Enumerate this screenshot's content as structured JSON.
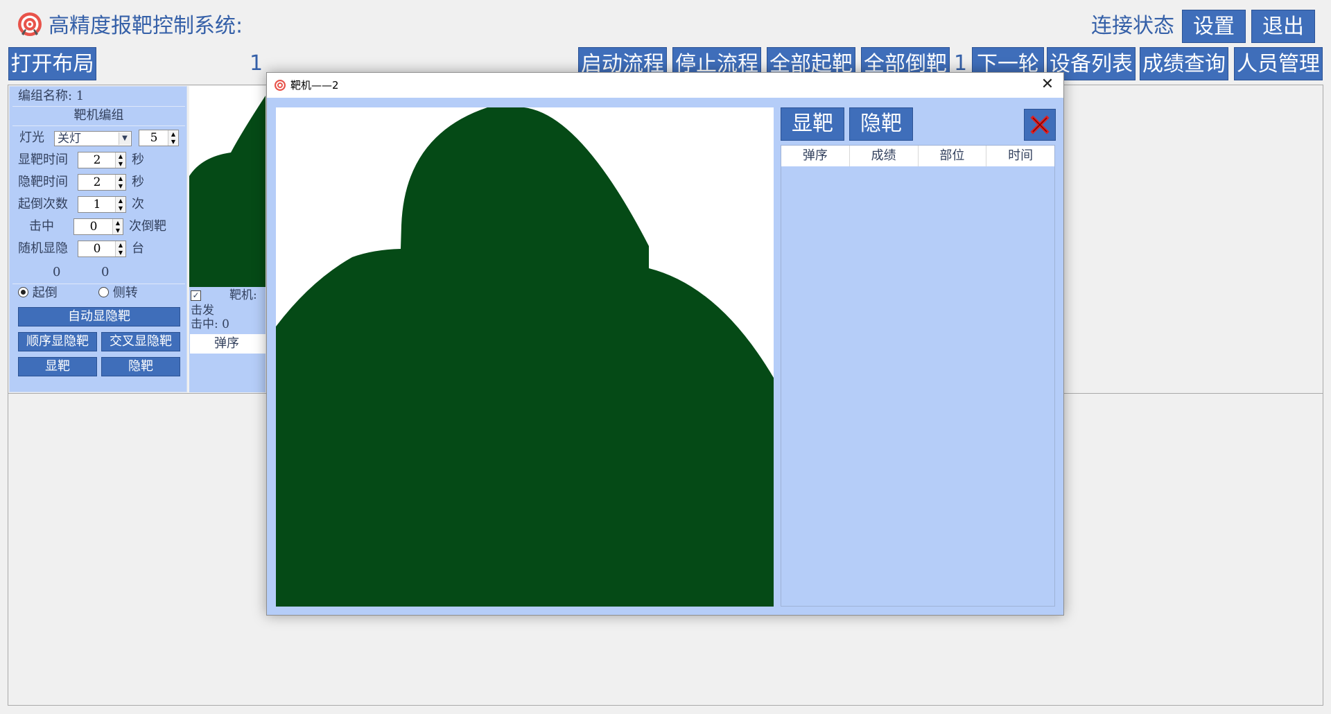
{
  "header": {
    "app_title": "高精度报靶控制系统:",
    "connection_label": "连接状态",
    "settings_label": "设置",
    "exit_label": "退出"
  },
  "toolbar": {
    "open_layout_label": "打开布局",
    "layout_number": "1",
    "round_number": "1",
    "buttons": [
      "启动流程",
      "停止流程",
      "全部起靶",
      "全部倒靶",
      "下一轮",
      "设备列表",
      "成绩查询",
      "人员管理"
    ]
  },
  "group_panel": {
    "group_name": "编组名称: 1",
    "section_title": "靶机编组",
    "light_label": "灯光",
    "light_value": "关灯",
    "light_number": "5",
    "show_time_label": "显靶时间",
    "show_time_value": "2",
    "hide_time_label": "隐靶时间",
    "hide_time_value": "2",
    "seconds_unit": "秒",
    "cycle_label": "起倒次数",
    "cycle_value": "1",
    "cycle_unit": "次",
    "hit_label": "击中",
    "hit_value": "0",
    "hit_unit": "次倒靶",
    "random_label": "随机显隐",
    "random_value": "0",
    "random_unit": "台",
    "counter_a": "0",
    "counter_b": "0",
    "radio_upright": "起倒",
    "radio_side": "侧转",
    "auto_btn": "自动显隐靶",
    "sequence_btn": "顺序显隐靶",
    "cross_btn": "交叉显隐靶",
    "show_btn": "显靶",
    "hide_btn": "隐靶"
  },
  "target_card": {
    "header_label": "靶机:",
    "shots_label": "击发",
    "hits_label": "击中: 0",
    "column_label": "弹序"
  },
  "dialog": {
    "title": "靶机——2",
    "show_btn": "显靶",
    "hide_btn": "隐靶",
    "columns": [
      "弹序",
      "成绩",
      "部位",
      "时间"
    ],
    "silhouette_color": "#054a16"
  }
}
